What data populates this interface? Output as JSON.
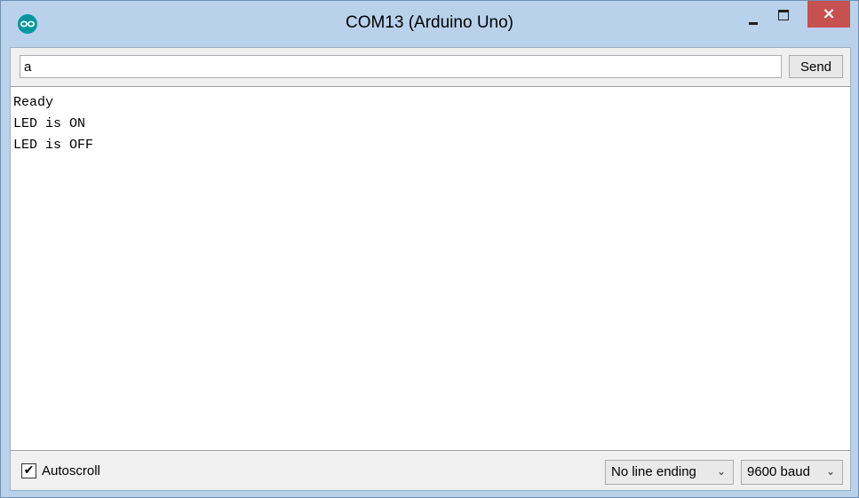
{
  "window": {
    "title": "COM13 (Arduino Uno)",
    "close_glyph": "×",
    "accent_close": "#c75050",
    "titlebar_color": "#b9d1ea"
  },
  "icons": {
    "app": "arduino-logo-icon",
    "minimize": "minimize-icon",
    "maximize": "maximize-icon",
    "close": "close-icon",
    "checkmark": "checkmark-icon",
    "chevron": "chevron-down-icon"
  },
  "send_bar": {
    "input_value": "a",
    "send_label": "Send"
  },
  "output": {
    "lines": [
      "Ready",
      "LED is ON",
      "LED is OFF"
    ]
  },
  "footer": {
    "autoscroll_label": "Autoscroll",
    "autoscroll_checked": true,
    "check_glyph": "✔",
    "line_ending": "No line ending",
    "baud_rate": "9600 baud",
    "chevron_glyph": "⌄"
  }
}
